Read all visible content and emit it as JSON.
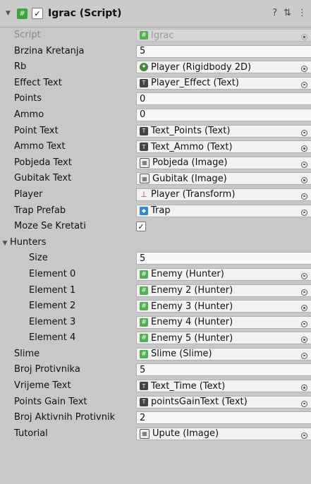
{
  "header": {
    "title": "Igrac (Script)",
    "fold_icon": "triangle-down",
    "script_icon": "#",
    "enabled_mark": "✓",
    "help_icon": "question-icon",
    "settings_icon": "sliders-icon",
    "menu_icon": "kebab-icon"
  },
  "fields": {
    "script": {
      "label": "Script",
      "value": "Igrac"
    },
    "brzina_kretanja": {
      "label": "Brzina Kretanja",
      "value": "5"
    },
    "rb": {
      "label": "Rb",
      "value": "Player (Rigidbody 2D)"
    },
    "effect_text": {
      "label": "Effect Text",
      "value": "Player_Effect (Text)"
    },
    "points": {
      "label": "Points",
      "value": "0"
    },
    "ammo": {
      "label": "Ammo",
      "value": "0"
    },
    "point_text": {
      "label": "Point Text",
      "value": "Text_Points (Text)"
    },
    "ammo_text": {
      "label": "Ammo Text",
      "value": "Text_Ammo (Text)"
    },
    "pobjeda_text": {
      "label": "Pobjeda Text",
      "value": "Pobjeda (Image)"
    },
    "gubitak_text": {
      "label": "Gubitak Text",
      "value": "Gubitak (Image)"
    },
    "player": {
      "label": "Player",
      "value": "Player (Transform)"
    },
    "trap_prefab": {
      "label": "Trap Prefab",
      "value": "Trap"
    },
    "moze_se_kretati": {
      "label": "Moze Se Kretati",
      "mark": "✓"
    },
    "hunters": {
      "label": "Hunters"
    },
    "size": {
      "label": "Size",
      "value": "5"
    },
    "element0": {
      "label": "Element 0",
      "value": "Enemy (Hunter)"
    },
    "element1": {
      "label": "Element 1",
      "value": "Enemy 2 (Hunter)"
    },
    "element2": {
      "label": "Element 2",
      "value": "Enemy 3 (Hunter)"
    },
    "element3": {
      "label": "Element 3",
      "value": "Enemy 4 (Hunter)"
    },
    "element4": {
      "label": "Element 4",
      "value": "Enemy 5 (Hunter)"
    },
    "slime": {
      "label": "Slime",
      "value": "Slime (Slime)"
    },
    "broj_protivnika": {
      "label": "Broj Protivnika",
      "value": "5"
    },
    "vrijeme_text": {
      "label": "Vrijeme Text",
      "value": "Text_Time (Text)"
    },
    "points_gain_text": {
      "label": "Points Gain Text",
      "value": "pointsGainText (Text)"
    },
    "broj_aktivnih": {
      "label": "Broj Aktivnih Protivnik",
      "value": "2"
    },
    "tutorial": {
      "label": "Tutorial",
      "value": "Upute (Image)"
    }
  }
}
